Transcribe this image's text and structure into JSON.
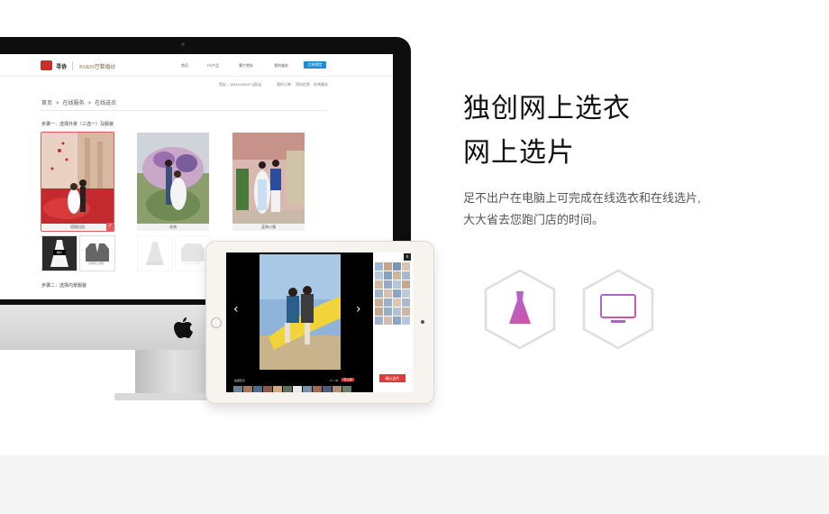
{
  "headline": {
    "line1": "独创网上选衣",
    "line2": "网上选片"
  },
  "description": {
    "line1": "足不出户在电脑上可完成在线选衣和在线选片,",
    "line2": "大大省去您跑门店的时间。"
  },
  "feature_icons": [
    {
      "icon": "dress-icon"
    },
    {
      "icon": "monitor-icon"
    }
  ],
  "colors": {
    "accent_purple": "#a36bdc",
    "accent_pink": "#d94fa0",
    "hex_border": "#dedede",
    "footer_band": "#f5f5f5"
  },
  "imac_screen": {
    "site": {
      "logo_text": "寻协",
      "brand": "PARIS巴黎婚纱",
      "nav": [
        "首页",
        "P1产品",
        "客片赏析",
        "我的服务"
      ],
      "nav_cta": "立刻预定",
      "userbar": "您好，18811140037  [退出]",
      "user_links": [
        "我的订单",
        "资料信息",
        "在线服务"
      ]
    },
    "breadcrumb": [
      "首页",
      "在线服务",
      "在线选衣"
    ],
    "step1": "步骤一：选择外景（三选一）及服装",
    "cards": [
      "塔楼旧园",
      "花海",
      "蓝海小镇"
    ],
    "thumbs": [
      {
        "caption": "",
        "badge": "婚纱"
      },
      {
        "caption": "选择男士服装"
      },
      {
        "caption": "选择婚纱款式"
      },
      {
        "caption": "选择男士服装"
      }
    ],
    "step2": "步骤二：选择内景服装"
  },
  "ipad_viewer": {
    "close_label": "x",
    "label_left": "拍摄套系",
    "label_flag": "已入选",
    "label_count": "17 / 48",
    "confirm_label": "确认选片",
    "prev_arrow": "‹",
    "next_arrow": "›"
  }
}
